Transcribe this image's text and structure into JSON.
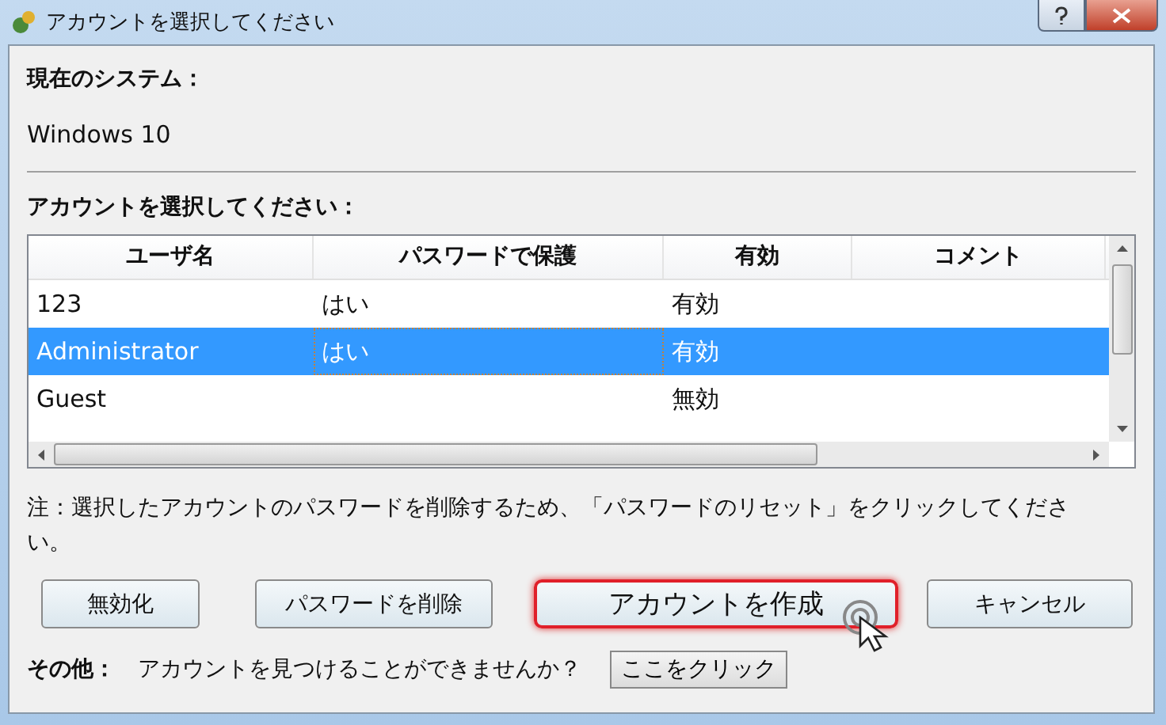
{
  "window": {
    "title": "アカウントを選択してください"
  },
  "system": {
    "label": "現在のシステム：",
    "value": "Windows 10"
  },
  "account_section": {
    "label": "アカウントを選択してください："
  },
  "table": {
    "columns": [
      "ユーザ名",
      "パスワードで保護",
      "有効",
      "コメント"
    ],
    "rows": [
      {
        "cells": [
          "123",
          "はい",
          "有効",
          ""
        ],
        "selected": false
      },
      {
        "cells": [
          "Administrator",
          "はい",
          "有効",
          ""
        ],
        "selected": true
      },
      {
        "cells": [
          "Guest",
          "",
          "無効",
          ""
        ],
        "selected": false
      }
    ]
  },
  "note": "注：選択したアカウントのパスワードを削除するため、「パスワードのリセット」をクリックしてください。",
  "buttons": [
    {
      "label": "無効化",
      "highlighted": false
    },
    {
      "label": "パスワードを削除",
      "highlighted": false
    },
    {
      "label": "アカウントを作成",
      "highlighted": true
    },
    {
      "label": "キャンセル",
      "highlighted": false
    }
  ],
  "other": {
    "label": "その他：",
    "text": "アカウントを見つけることができませんか？",
    "button": "ここをクリック"
  }
}
